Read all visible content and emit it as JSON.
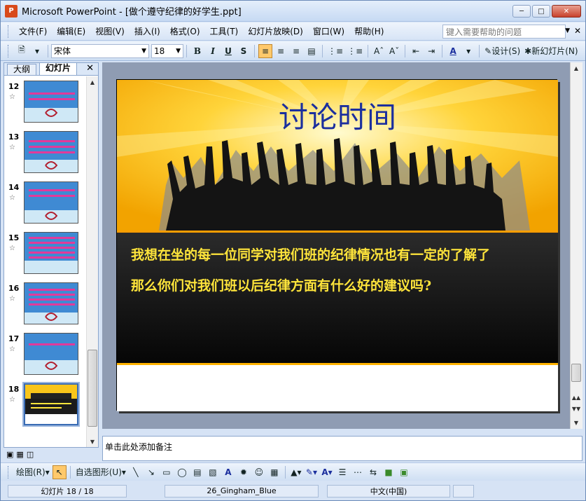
{
  "window": {
    "title": "Microsoft PowerPoint - [做个遵守纪律的好学生.ppt]",
    "app_icon": "P"
  },
  "menu": [
    "文件(F)",
    "编辑(E)",
    "视图(V)",
    "插入(I)",
    "格式(O)",
    "工具(T)",
    "幻灯片放映(D)",
    "窗口(W)",
    "帮助(H)"
  ],
  "help_placeholder": "键入需要帮助的问题",
  "toolbar": {
    "font": "宋体",
    "size": "18",
    "design": "设计(S)",
    "new_slide": "新幻灯片(N)"
  },
  "panel": {
    "tab_outline": "大纲",
    "tab_slides": "幻灯片"
  },
  "thumbnails": [
    {
      "num": "12"
    },
    {
      "num": "13"
    },
    {
      "num": "14"
    },
    {
      "num": "15"
    },
    {
      "num": "16"
    },
    {
      "num": "17"
    },
    {
      "num": "18"
    }
  ],
  "slide": {
    "title": "讨论时间",
    "line1": "我想在坐的每一位同学对我们班的纪律情况也有一定的了解了",
    "line2": "那么你们对我们班以后纪律方面有什么好的建议吗?"
  },
  "notes_placeholder": "单击此处添加备注",
  "drawbar": {
    "draw": "绘图(R)",
    "autoshapes": "自选图形(U)"
  },
  "status": {
    "slide": "幻灯片 18 / 18",
    "theme": "26_Gingham_Blue",
    "lang": "中文(中国)"
  },
  "colors": {
    "accent": "#3a6cb4",
    "title": "#1b2f9e",
    "slide_text": "#ffe53b"
  }
}
